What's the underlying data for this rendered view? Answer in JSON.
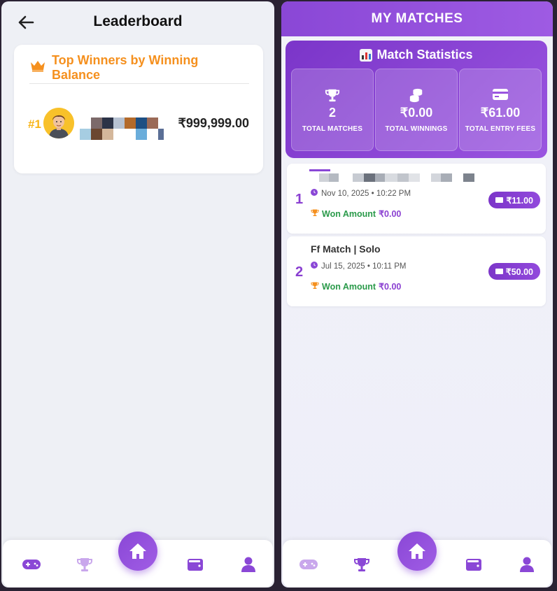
{
  "leaderboard": {
    "title": "Leaderboard",
    "card_title": "Top Winners by Winning Balance",
    "winners": [
      {
        "rank": "#1",
        "amount": "₹999,999.00"
      }
    ]
  },
  "matches": {
    "title": "MY MATCHES",
    "stats_title": "Match Statistics",
    "stats": [
      {
        "value": "2",
        "label": "TOTAL MATCHES",
        "icon": "trophy-icon"
      },
      {
        "value": "₹0.00",
        "label": "TOTAL WINNINGS",
        "icon": "coins-icon"
      },
      {
        "value": "₹61.00",
        "label": "TOTAL ENTRY FEES",
        "icon": "card-icon"
      }
    ],
    "list": [
      {
        "index": "1",
        "name": "",
        "date": "Nov 10, 2025 • 10:22 PM",
        "won_label": "Won Amount",
        "won_value": "₹0.00",
        "fee": "₹11.00"
      },
      {
        "index": "2",
        "name": "Ff Match | Solo",
        "date": "Jul 15, 2025 • 10:11 PM",
        "won_label": "Won Amount",
        "won_value": "₹0.00",
        "fee": "₹50.00"
      }
    ]
  },
  "nav": {
    "items": [
      "gamepad-icon",
      "trophy-icon",
      "home-icon",
      "wallet-icon",
      "user-icon"
    ]
  },
  "colors": {
    "accent": "#8a47d6",
    "orange": "#f5901e",
    "green": "#2a9a4a"
  }
}
